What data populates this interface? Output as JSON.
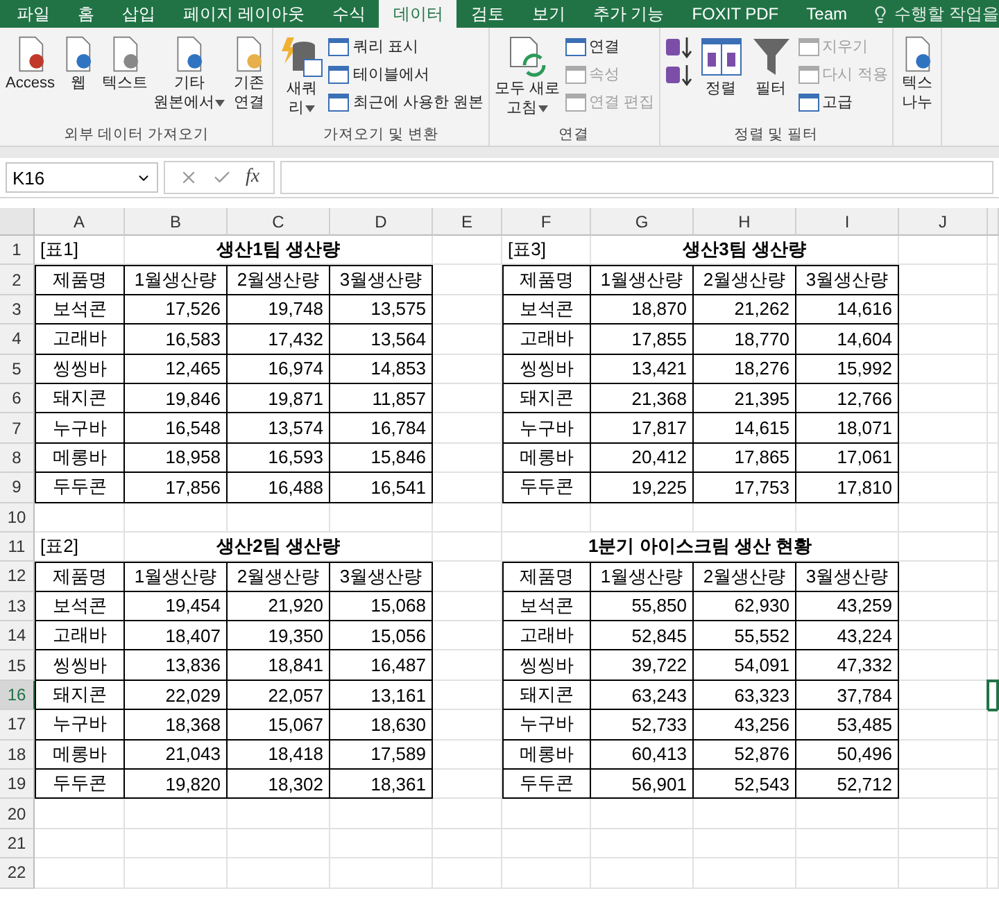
{
  "ribbon": {
    "tabs": [
      {
        "label": "파일",
        "selected": false
      },
      {
        "label": "홈",
        "selected": false
      },
      {
        "label": "삽입",
        "selected": false
      },
      {
        "label": "페이지 레이아웃",
        "selected": false
      },
      {
        "label": "수식",
        "selected": false
      },
      {
        "label": "데이터",
        "selected": true
      },
      {
        "label": "검토",
        "selected": false
      },
      {
        "label": "보기",
        "selected": false
      },
      {
        "label": "추가 기능",
        "selected": false
      },
      {
        "label": "FOXIT PDF",
        "selected": false
      },
      {
        "label": "Team",
        "selected": false
      }
    ],
    "tell_me": "수행할 작업을",
    "groups": [
      {
        "label": "외부 데이터 가져오기",
        "items": [
          {
            "kind": "large",
            "lines": [
              "Access"
            ]
          },
          {
            "kind": "large",
            "lines": [
              "웹"
            ]
          },
          {
            "kind": "large",
            "lines": [
              "텍스트"
            ]
          },
          {
            "kind": "large",
            "lines": [
              "기타",
              "원본에서"
            ],
            "dropdown": true
          },
          {
            "kind": "large",
            "lines": [
              "기존",
              "연결"
            ]
          }
        ]
      },
      {
        "label": "가져오기 및 변환",
        "items": [
          {
            "kind": "large",
            "lines": [
              "새쿼",
              "리"
            ],
            "dropdown": true
          },
          {
            "kind": "small",
            "lines": [
              "쿼리 표시"
            ],
            "disabled": false
          },
          {
            "kind": "small",
            "lines": [
              "테이블에서"
            ],
            "disabled": false
          },
          {
            "kind": "small",
            "lines": [
              "최근에 사용한 원본"
            ],
            "disabled": false
          }
        ]
      },
      {
        "label": "연결",
        "items": [
          {
            "kind": "large",
            "lines": [
              "모두 새로",
              "고침"
            ],
            "dropdown": true
          },
          {
            "kind": "small",
            "lines": [
              "연결"
            ],
            "disabled": false
          },
          {
            "kind": "small",
            "lines": [
              "속성"
            ],
            "disabled": true
          },
          {
            "kind": "small",
            "lines": [
              "연결 편집"
            ],
            "disabled": true
          }
        ]
      },
      {
        "label": "정렬 및 필터",
        "items": [
          {
            "kind": "icon"
          },
          {
            "kind": "icon"
          },
          {
            "kind": "large",
            "lines": [
              "정렬"
            ]
          },
          {
            "kind": "large",
            "lines": [
              "필터"
            ]
          },
          {
            "kind": "small",
            "lines": [
              "지우기"
            ],
            "disabled": true
          },
          {
            "kind": "small",
            "lines": [
              "다시 적용"
            ],
            "disabled": true
          },
          {
            "kind": "small",
            "lines": [
              "고급"
            ],
            "disabled": false
          }
        ]
      },
      {
        "items": [
          {
            "kind": "large",
            "lines": [
              "텍스",
              "나누"
            ]
          }
        ]
      }
    ]
  },
  "formula_bar": {
    "name_box": "K16",
    "fx": "fx"
  },
  "sheet": {
    "columns": [
      "A",
      "B",
      "C",
      "D",
      "E",
      "F",
      "G",
      "H",
      "I",
      "J"
    ],
    "rows": [
      {
        "number": "1",
        "selected": false
      },
      {
        "number": "2",
        "selected": false
      },
      {
        "number": "3",
        "selected": false
      },
      {
        "number": "4",
        "selected": false
      },
      {
        "number": "5",
        "selected": false
      },
      {
        "number": "6",
        "selected": false
      },
      {
        "number": "7",
        "selected": false
      },
      {
        "number": "8",
        "selected": false
      },
      {
        "number": "9",
        "selected": false
      },
      {
        "number": "10",
        "selected": false
      },
      {
        "number": "11",
        "selected": false
      },
      {
        "number": "12",
        "selected": false
      },
      {
        "number": "13",
        "selected": false
      },
      {
        "number": "14",
        "selected": false
      },
      {
        "number": "15",
        "selected": false
      },
      {
        "number": "16",
        "selected": true
      },
      {
        "number": "17",
        "selected": false
      },
      {
        "number": "18",
        "selected": false
      },
      {
        "number": "19",
        "selected": false
      },
      {
        "number": "20",
        "selected": false
      },
      {
        "number": "21",
        "selected": false
      },
      {
        "number": "22",
        "selected": false
      }
    ],
    "tables": [
      {
        "note": "[표1]",
        "title": "생산1팀 생산량",
        "headers": [
          "제품명",
          "1월생산량",
          "2월생산량",
          "3월생산량"
        ],
        "rows": [
          [
            "보석콘",
            "17,526",
            "19,748",
            "13,575"
          ],
          [
            "고래바",
            "16,583",
            "17,432",
            "13,564"
          ],
          [
            "씽씽바",
            "12,465",
            "16,974",
            "14,853"
          ],
          [
            "돼지콘",
            "19,846",
            "19,871",
            "11,857"
          ],
          [
            "누구바",
            "16,548",
            "13,574",
            "16,784"
          ],
          [
            "메롱바",
            "18,958",
            "16,593",
            "15,846"
          ],
          [
            "두두콘",
            "17,856",
            "16,488",
            "16,541"
          ]
        ]
      },
      {
        "note": "[표3]",
        "title": "생산3팀 생산량",
        "headers": [
          "제품명",
          "1월생산량",
          "2월생산량",
          "3월생산량"
        ],
        "rows": [
          [
            "보석콘",
            "18,870",
            "21,262",
            "14,616"
          ],
          [
            "고래바",
            "17,855",
            "18,770",
            "14,604"
          ],
          [
            "씽씽바",
            "13,421",
            "18,276",
            "15,992"
          ],
          [
            "돼지콘",
            "21,368",
            "21,395",
            "12,766"
          ],
          [
            "누구바",
            "17,817",
            "14,615",
            "18,071"
          ],
          [
            "메롱바",
            "20,412",
            "17,865",
            "17,061"
          ],
          [
            "두두콘",
            "19,225",
            "17,753",
            "17,810"
          ]
        ]
      },
      {
        "note": "[표2]",
        "title": "생산2팀 생산량",
        "headers": [
          "제품명",
          "1월생산량",
          "2월생산량",
          "3월생산량"
        ],
        "rows": [
          [
            "보석콘",
            "19,454",
            "21,920",
            "15,068"
          ],
          [
            "고래바",
            "18,407",
            "19,350",
            "15,056"
          ],
          [
            "씽씽바",
            "13,836",
            "18,841",
            "16,487"
          ],
          [
            "돼지콘",
            "22,029",
            "22,057",
            "13,161"
          ],
          [
            "누구바",
            "18,368",
            "15,067",
            "18,630"
          ],
          [
            "메롱바",
            "21,043",
            "18,418",
            "17,589"
          ],
          [
            "두두콘",
            "19,820",
            "18,302",
            "18,361"
          ]
        ]
      },
      {
        "title": "1분기 아이스크림 생산 현황",
        "headers": [
          "제품명",
          "1월생산량",
          "2월생산량",
          "3월생산량"
        ],
        "rows": [
          [
            "보석콘",
            "55,850",
            "62,930",
            "43,259"
          ],
          [
            "고래바",
            "52,845",
            "55,552",
            "43,224"
          ],
          [
            "씽씽바",
            "39,722",
            "54,091",
            "47,332"
          ],
          [
            "돼지콘",
            "63,243",
            "63,323",
            "37,784"
          ],
          [
            "누구바",
            "52,733",
            "43,256",
            "53,485"
          ],
          [
            "메롱바",
            "60,413",
            "52,876",
            "50,496"
          ],
          [
            "두두콘",
            "56,901",
            "52,543",
            "52,712"
          ]
        ]
      }
    ]
  }
}
